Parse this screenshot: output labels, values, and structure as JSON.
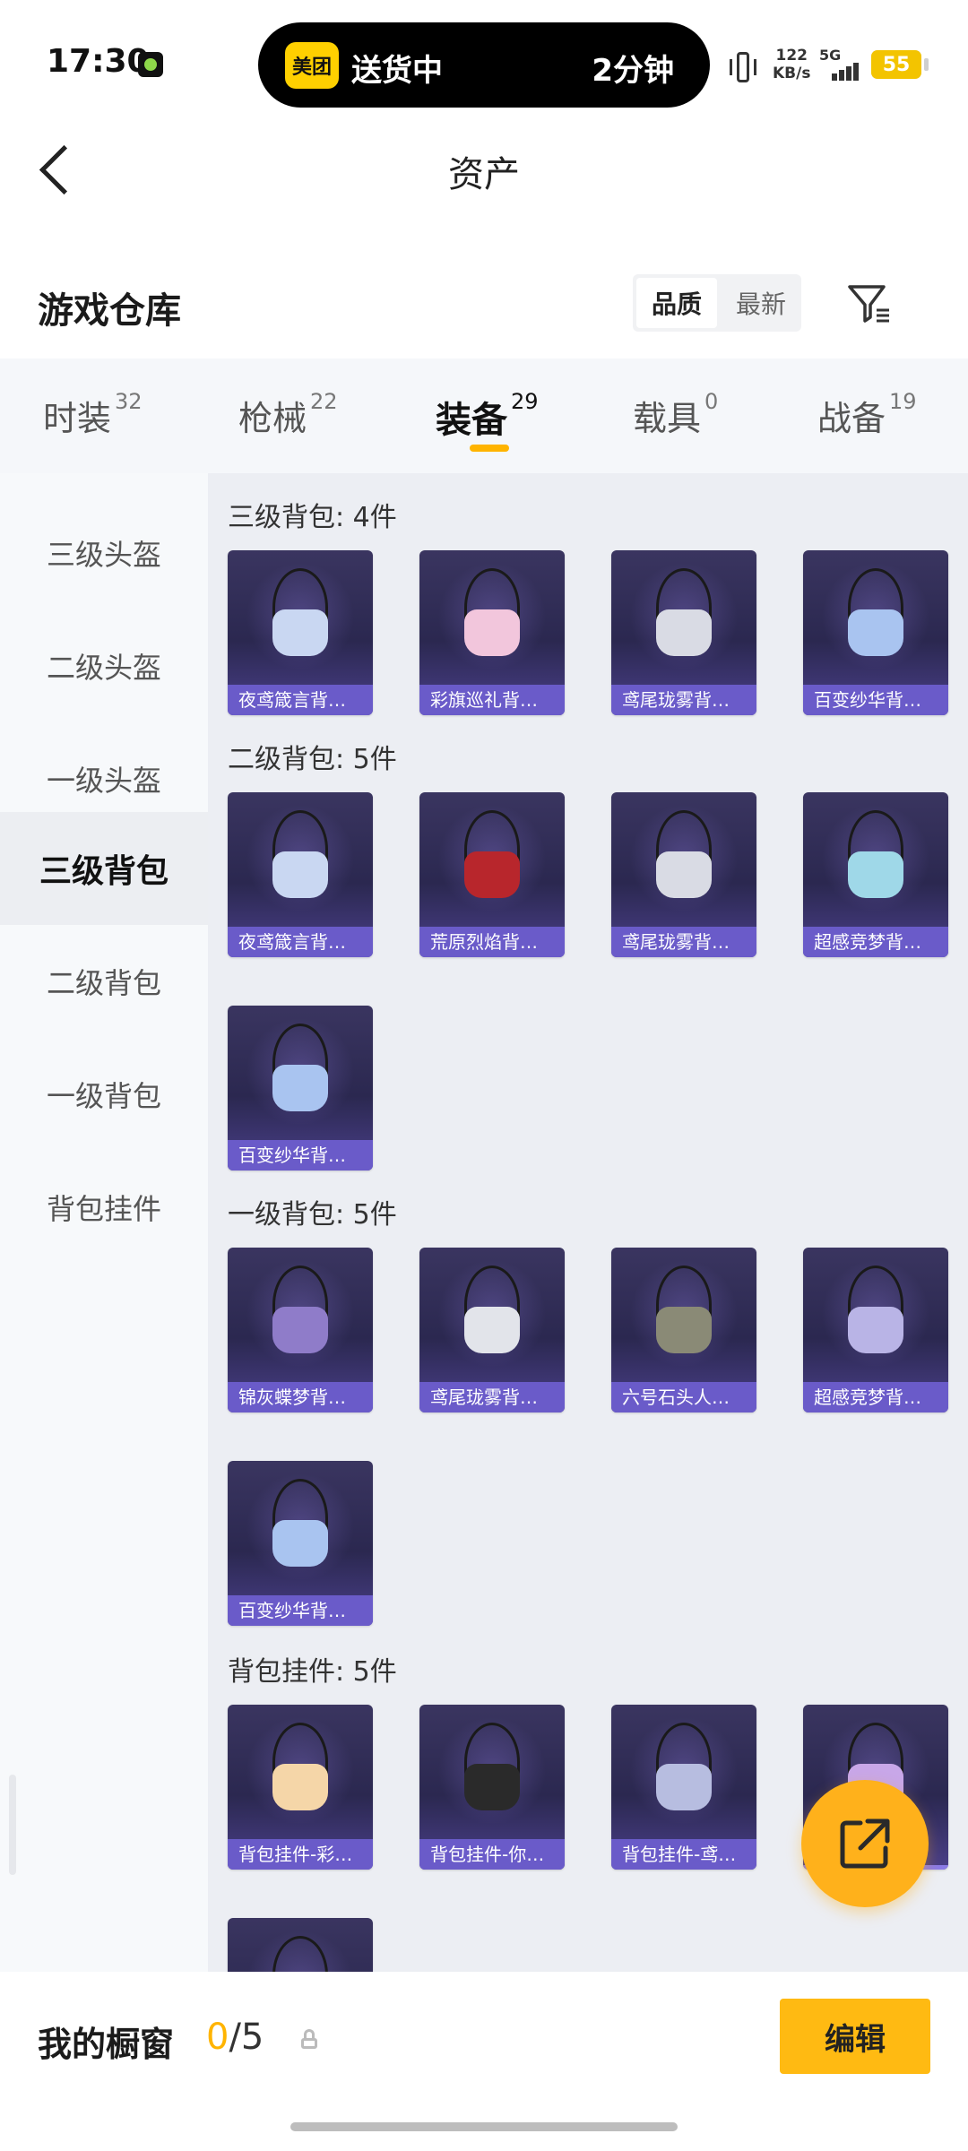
{
  "status_bar": {
    "time": "17:30",
    "island_brand": "美团",
    "island_status": "送货中",
    "island_eta": "2分钟",
    "net_speed_value": "122",
    "net_speed_unit": "KB/s",
    "network": "5G",
    "battery": "55"
  },
  "header": {
    "title": "资产"
  },
  "warehouse": {
    "title": "游戏仓库",
    "sort_options": [
      "品质",
      "最新"
    ],
    "active_sort": "品质"
  },
  "tabs": [
    {
      "label": "时装",
      "count": "32"
    },
    {
      "label": "枪械",
      "count": "22"
    },
    {
      "label": "装备",
      "count": "29"
    },
    {
      "label": "载具",
      "count": "0"
    },
    {
      "label": "战备",
      "count": "19"
    }
  ],
  "active_tab": "装备",
  "sidebar": [
    {
      "label": "三级头盔"
    },
    {
      "label": "二级头盔"
    },
    {
      "label": "一级头盔"
    },
    {
      "label": "三级背包"
    },
    {
      "label": "二级背包"
    },
    {
      "label": "一级背包"
    },
    {
      "label": "背包挂件"
    }
  ],
  "active_sidebar": "三级背包",
  "groups": [
    {
      "title": "三级背包: 4件",
      "items": [
        {
          "name": "夜鸢箴言背…",
          "bag_color": "#c9d7f2"
        },
        {
          "name": "彩旗巡礼背…",
          "bag_color": "#f2c6dc"
        },
        {
          "name": "鸢尾珑雾背…",
          "bag_color": "#d9dbe4"
        },
        {
          "name": "百变纱华背…",
          "bag_color": "#a9c4f0"
        }
      ]
    },
    {
      "title": "二级背包: 5件",
      "items": [
        {
          "name": "夜鸢箴言背…",
          "bag_color": "#c9d7f2"
        },
        {
          "name": "荒原烈焰背…",
          "bag_color": "#b8262c"
        },
        {
          "name": "鸢尾珑雾背…",
          "bag_color": "#d9dbe4"
        },
        {
          "name": "超感竞梦背…",
          "bag_color": "#9fd8e8"
        },
        {
          "name": "百变纱华背…",
          "bag_color": "#a9c4f0"
        }
      ]
    },
    {
      "title": "一级背包: 5件",
      "items": [
        {
          "name": "锦灰蝶梦背…",
          "bag_color": "#8f7cc9"
        },
        {
          "name": "鸢尾珑雾背…",
          "bag_color": "#e2e4ea"
        },
        {
          "name": "六号石头人…",
          "bag_color": "#8a8a76"
        },
        {
          "name": "超感竞梦背…",
          "bag_color": "#b9b4e6"
        },
        {
          "name": "百变纱华背…",
          "bag_color": "#a9c4f0"
        }
      ]
    },
    {
      "title": "背包挂件: 5件",
      "items": [
        {
          "name": "背包挂件-彩…",
          "bag_color": "#f5d6a8"
        },
        {
          "name": "背包挂件-你…",
          "bag_color": "#2a2a2a"
        },
        {
          "name": "背包挂件-鸢…",
          "bag_color": "#b7bde0"
        },
        {
          "name": "",
          "bag_color": "#c8a7e8"
        },
        {
          "name": "",
          "bag_color": "#5c567e"
        }
      ]
    }
  ],
  "bottom": {
    "showcase_label": "我的橱窗",
    "showcase_current": "0",
    "showcase_total": "/5",
    "edit_label": "编辑"
  },
  "colors": {
    "accent": "#ffb400",
    "card_label": "#6a5bc9",
    "card_bg": "#2b2850"
  },
  "icons": {
    "back": "back-chevron-icon",
    "filter": "filter-icon",
    "share": "share-export-icon",
    "lock": "lock-icon"
  }
}
